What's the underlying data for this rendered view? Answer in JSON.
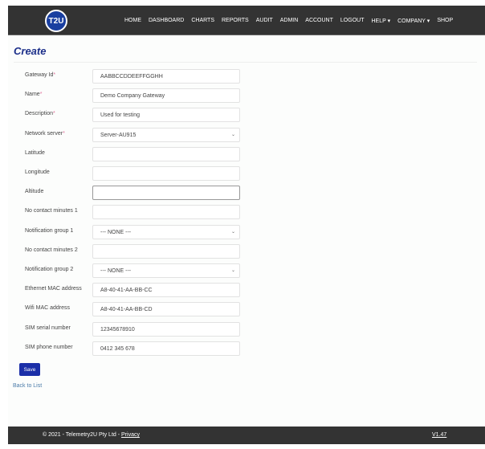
{
  "nav": {
    "logo": "T2U",
    "items": [
      "HOME",
      "DASHBOARD",
      "CHARTS",
      "REPORTS",
      "AUDIT",
      "ADMIN",
      "ACCOUNT",
      "LOGOUT",
      "HELP ▾",
      "COMPANY ▾",
      "SHOP"
    ]
  },
  "page_title": "Create",
  "fields": [
    {
      "label": "Gateway Id",
      "required": "*",
      "value": "AABBCCDDEEFFGGHH",
      "type": "text"
    },
    {
      "label": "Name",
      "required": "*",
      "value": "Demo Company Gateway",
      "type": "text"
    },
    {
      "label": "Description",
      "required": "*",
      "value": "Used for testing",
      "type": "text"
    },
    {
      "label": "Network server",
      "required": "*",
      "value": "Server-AU915",
      "type": "select"
    },
    {
      "label": "Latitude",
      "value": "",
      "type": "text"
    },
    {
      "label": "Longitude",
      "value": "",
      "type": "text"
    },
    {
      "label": "Altitude",
      "value": "",
      "type": "text"
    },
    {
      "label": "No contact minutes 1",
      "value": "",
      "type": "text"
    },
    {
      "label": "Notification group 1",
      "value": "--- NONE ---",
      "type": "select"
    },
    {
      "label": "No contact minutes 2",
      "value": "",
      "type": "text"
    },
    {
      "label": "Notification group 2",
      "value": "--- NONE ---",
      "type": "select"
    },
    {
      "label": "Ethernet MAC address",
      "value": "A8-40-41-AA-BB-CC",
      "type": "text"
    },
    {
      "label": "Wifi MAC address",
      "value": "A8-40-41-AA-BB-CD",
      "type": "text"
    },
    {
      "label": "SIM serial number",
      "value": "12345678910",
      "type": "text"
    },
    {
      "label": "SIM phone number",
      "value": "0412 345 678",
      "type": "text"
    }
  ],
  "save_label": "Save",
  "back_label": "Back to List",
  "footer": {
    "copyright": "© 2021 - Telemetry2U Pty Ltd - ",
    "privacy": "Privacy",
    "version": "V1.47"
  }
}
